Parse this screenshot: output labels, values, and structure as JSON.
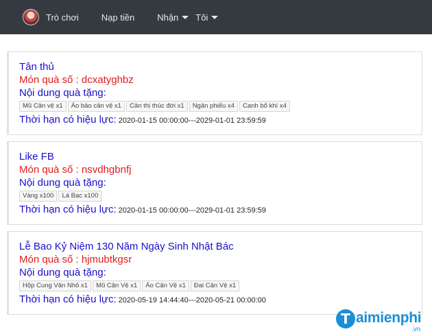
{
  "nav": {
    "games": "Trò chơi",
    "deposit": "Nạp tiền",
    "receive": "Nhận",
    "me": "Tôi"
  },
  "gifts": [
    {
      "title": "Tân thủ",
      "code_line": "Món quà số : dcxatyghbz",
      "content_label": "Nội dung quà tặng:",
      "items": [
        "Mũ Cân vệ x1",
        "Áo bảo cân vệ x1",
        "Cân thị thúc đới x1",
        "Ngân phiếu x4",
        "Canh bổ khí x4"
      ],
      "validity_label": "Thời hạn có hiệu lực:",
      "validity_range": "2020-01-15 00:00:00---2029-01-01 23:59:59"
    },
    {
      "title": "Like FB",
      "code_line": "Món quà số : nsvdhgbnfj",
      "content_label": "Nội dung quà tặng:",
      "items": [
        "Vàng x100",
        "Lá Bạc x100"
      ],
      "validity_label": "Thời hạn có hiệu lực:",
      "validity_range": "2020-01-15 00:00:00---2029-01-01 23:59:59"
    },
    {
      "title": "Lễ Bao Kỷ Niệm 130 Năm Ngày Sinh Nhật Bác",
      "code_line": "Món quà số : hjmubtkgsr",
      "content_label": "Nội dung quà tặng:",
      "items": [
        "Hộp Cung Vân Nhỏ x1",
        "Mũ Cận Vệ x1",
        "Áo Cận Vệ x1",
        "Đai Cận Vệ x1"
      ],
      "validity_label": "Thời hạn có hiệu lực:",
      "validity_range": "2020-05-19 14:44:40---2020-05-21 00:00:00"
    }
  ],
  "watermark": {
    "letter": "T",
    "text": "aimienphi",
    "suffix": ".vn"
  }
}
